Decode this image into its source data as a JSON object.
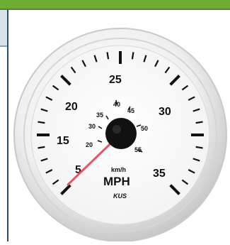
{
  "gauge": {
    "mph_numbers": [
      "5",
      "15",
      "20",
      "25",
      "30",
      "35"
    ],
    "kmh_numbers": [
      "20",
      "30",
      "35",
      "40",
      "45",
      "50",
      "55"
    ],
    "unit_small": "km/h",
    "unit_large": "MPH",
    "brand": "KUS",
    "colors": {
      "header_bar": "#6fae35",
      "frame_border": "#2b4b6a",
      "needle": "#e8536b",
      "hub": "#111111"
    }
  }
}
